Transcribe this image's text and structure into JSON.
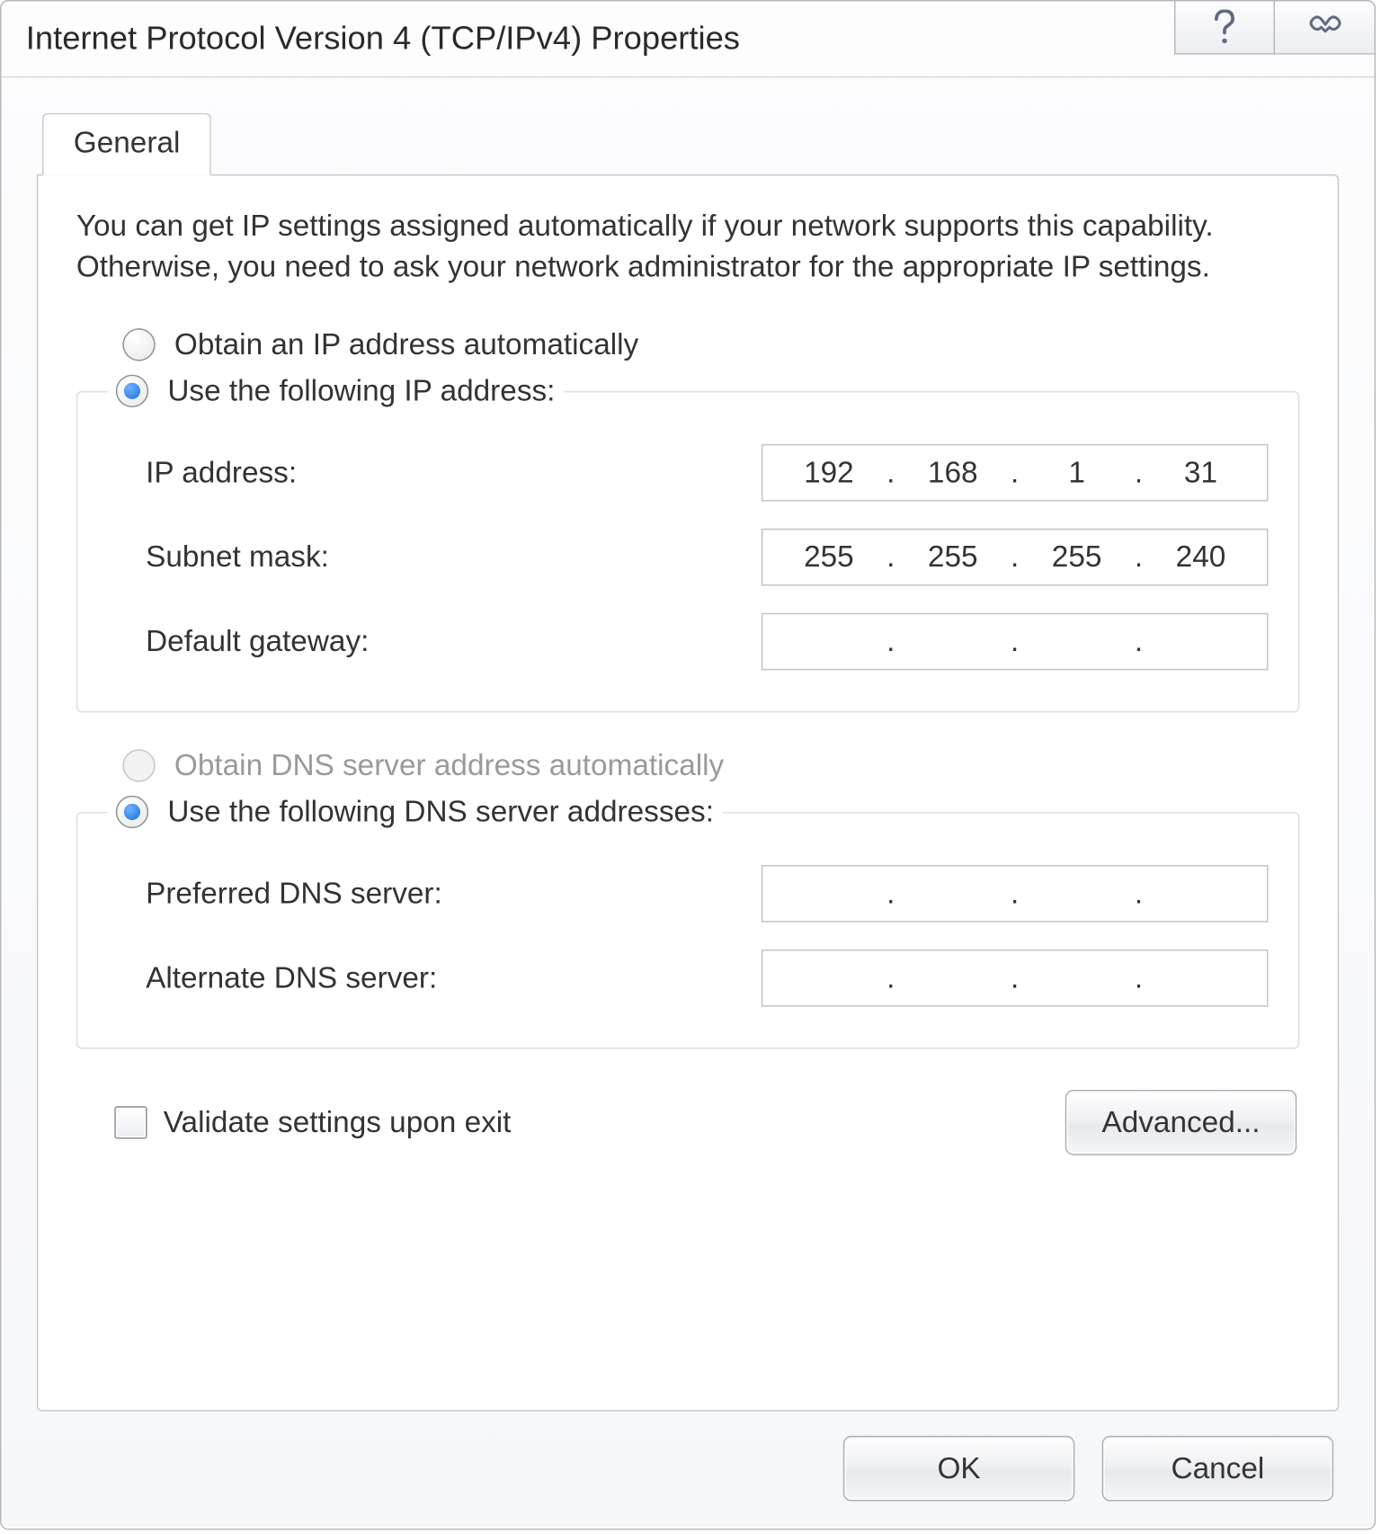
{
  "window": {
    "title": "Internet Protocol Version 4 (TCP/IPv4) Properties"
  },
  "tabs": {
    "general": "General"
  },
  "description": "You can get IP settings assigned automatically if your network supports this capability. Otherwise, you need to ask your network administrator for the appropriate IP settings.",
  "ip": {
    "obtain_auto": "Obtain an IP address automatically",
    "use_following": "Use the following IP address:",
    "address_label": "IP address:",
    "subnet_label": "Subnet mask:",
    "gateway_label": "Default gateway:",
    "address": {
      "a": "192",
      "b": "168",
      "c": "1",
      "d": "31"
    },
    "subnet": {
      "a": "255",
      "b": "255",
      "c": "255",
      "d": "240"
    },
    "gateway": {
      "a": "",
      "b": "",
      "c": "",
      "d": ""
    }
  },
  "dns": {
    "obtain_auto": "Obtain DNS server address automatically",
    "use_following": "Use the following DNS server addresses:",
    "preferred_label": "Preferred DNS server:",
    "alternate_label": "Alternate DNS server:",
    "preferred": {
      "a": "",
      "b": "",
      "c": "",
      "d": ""
    },
    "alternate": {
      "a": "",
      "b": "",
      "c": "",
      "d": ""
    }
  },
  "validate_label": "Validate settings upon exit",
  "buttons": {
    "advanced": "Advanced...",
    "ok": "OK",
    "cancel": "Cancel"
  }
}
